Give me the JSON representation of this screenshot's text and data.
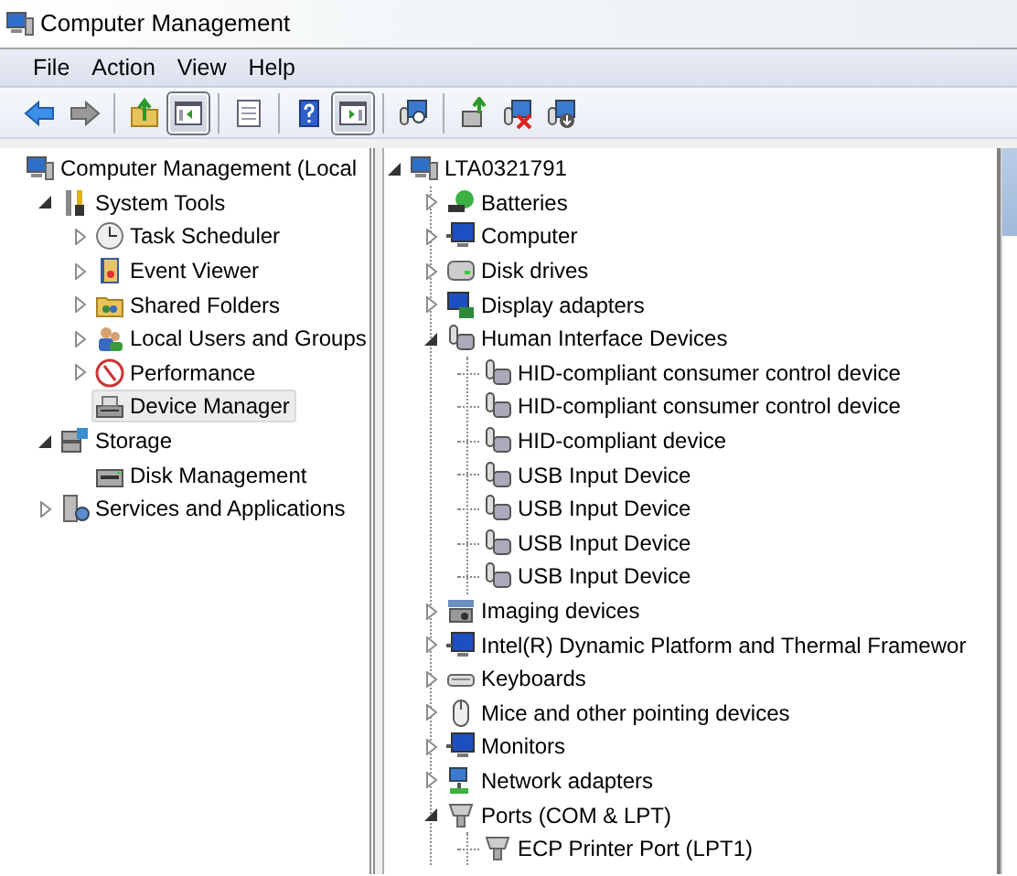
{
  "window": {
    "title": "Computer Management"
  },
  "menu": [
    {
      "label": "File"
    },
    {
      "label": "Action"
    },
    {
      "label": "View"
    },
    {
      "label": "Help"
    }
  ],
  "toolbar": [
    {
      "kind": "button",
      "pressed": false
    },
    {
      "kind": "button",
      "pressed": false
    },
    {
      "kind": "separator"
    },
    {
      "kind": "button",
      "pressed": false
    },
    {
      "kind": "button",
      "pressed": true
    },
    {
      "kind": "separator"
    },
    {
      "kind": "button",
      "pressed": false
    },
    {
      "kind": "separator"
    },
    {
      "kind": "button",
      "pressed": false
    },
    {
      "kind": "button",
      "pressed": true
    },
    {
      "kind": "separator"
    },
    {
      "kind": "button",
      "pressed": false
    },
    {
      "kind": "separator"
    },
    {
      "kind": "button",
      "pressed": false
    },
    {
      "kind": "button",
      "pressed": false
    },
    {
      "kind": "button",
      "pressed": false
    }
  ],
  "console_tree": {
    "items": [
      {
        "label": "Computer Management (Local",
        "selected": false,
        "children": [
          {
            "label": "System Tools",
            "selected": false,
            "expanded": true,
            "children": [
              {
                "label": "Task Scheduler",
                "selected": false,
                "expanded": false
              },
              {
                "label": "Event Viewer",
                "selected": false,
                "expanded": false
              },
              {
                "label": "Shared Folders",
                "selected": false,
                "expanded": false
              },
              {
                "label": "Local Users and Groups",
                "selected": false,
                "expanded": false
              },
              {
                "label": "Performance",
                "selected": false,
                "expanded": false
              },
              {
                "label": "Device Manager",
                "selected": true
              }
            ]
          },
          {
            "label": "Storage",
            "selected": false,
            "expanded": true,
            "children": [
              {
                "label": "Disk Management",
                "selected": false
              }
            ]
          },
          {
            "label": "Services and Applications",
            "selected": false,
            "expanded": false
          }
        ]
      }
    ]
  },
  "device_tree": {
    "items": [
      {
        "label": "LTA0321791",
        "expanded": true,
        "children": [
          {
            "label": "Batteries",
            "expanded": false
          },
          {
            "label": "Computer",
            "expanded": false
          },
          {
            "label": "Disk drives",
            "expanded": false
          },
          {
            "label": "Display adapters",
            "expanded": false
          },
          {
            "label": "Human Interface Devices",
            "expanded": true,
            "children": [
              {
                "label": "HID-compliant consumer control device"
              },
              {
                "label": "HID-compliant consumer control device"
              },
              {
                "label": "HID-compliant device"
              },
              {
                "label": "USB Input Device"
              },
              {
                "label": "USB Input Device"
              },
              {
                "label": "USB Input Device"
              },
              {
                "label": "USB Input Device"
              }
            ]
          },
          {
            "label": "Imaging devices",
            "expanded": false
          },
          {
            "label": "Intel(R) Dynamic Platform and Thermal Framewor",
            "expanded": false
          },
          {
            "label": "Keyboards",
            "expanded": false
          },
          {
            "label": "Mice and other pointing devices",
            "expanded": false
          },
          {
            "label": "Monitors",
            "expanded": false
          },
          {
            "label": "Network adapters",
            "expanded": false
          },
          {
            "label": "Ports (COM & LPT)",
            "expanded": true,
            "children": [
              {
                "label": "ECP Printer Port (LPT1)"
              }
            ]
          }
        ]
      }
    ]
  }
}
